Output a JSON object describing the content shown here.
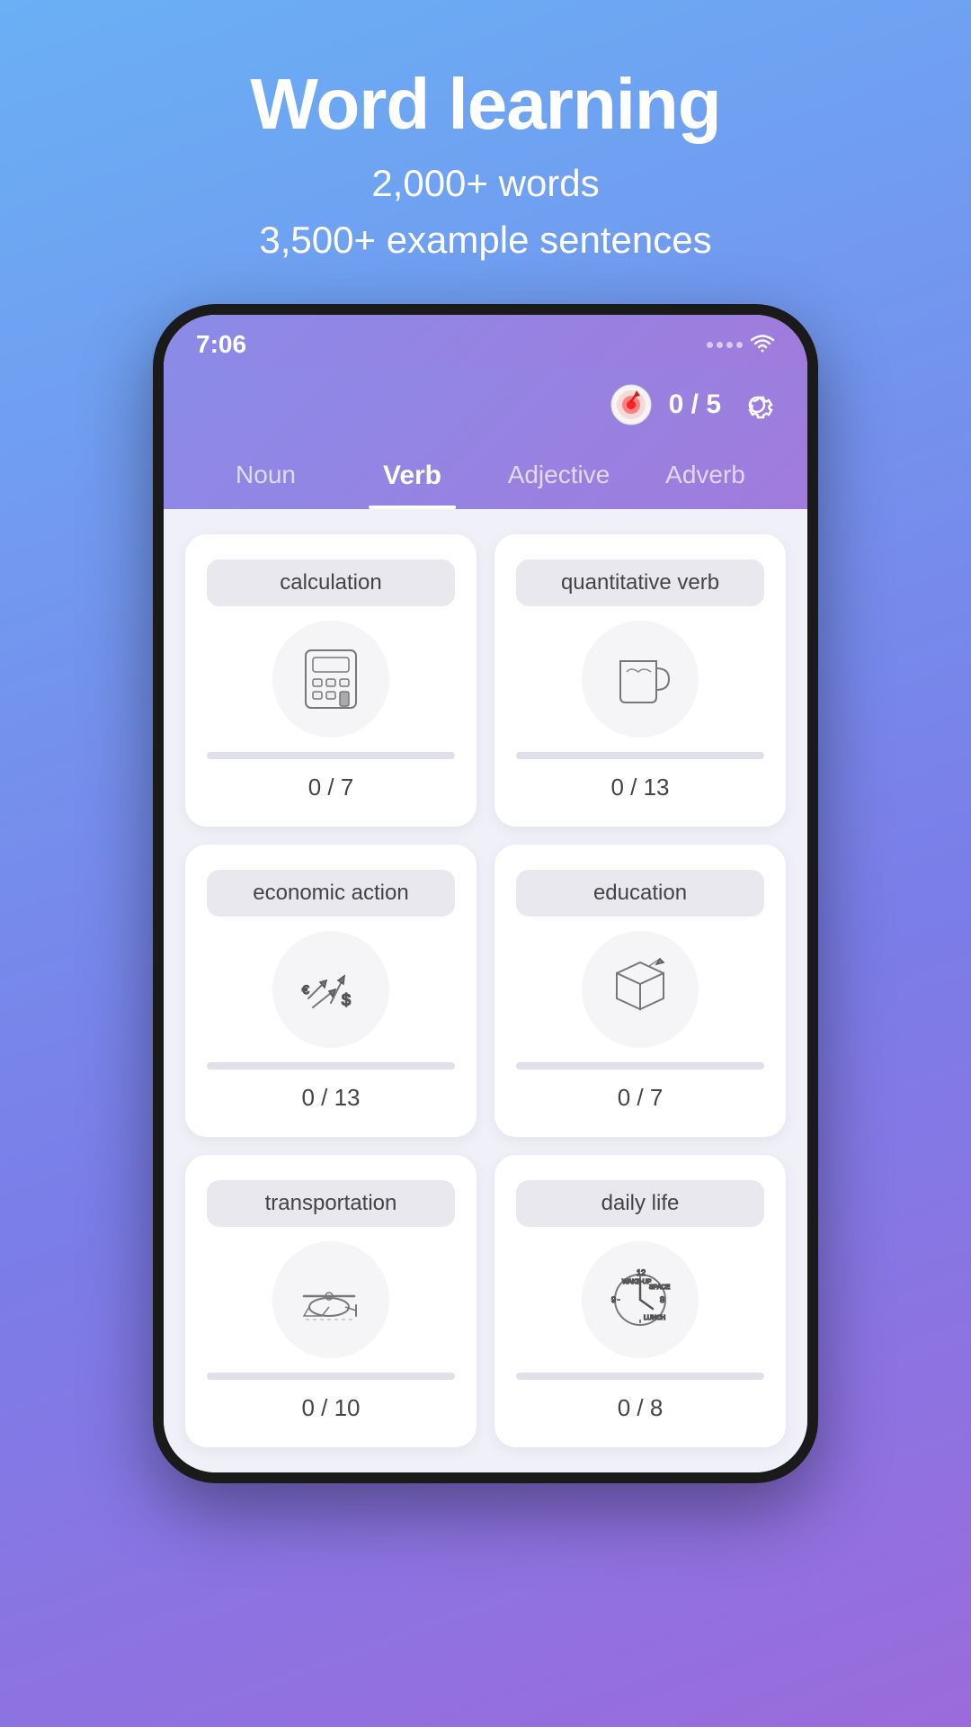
{
  "header": {
    "title": "Word learning",
    "subtitle_line1": "2,000+ words",
    "subtitle_line2": "3,500+ example sentences"
  },
  "status_bar": {
    "time": "7:06"
  },
  "app_header": {
    "score_label": "0 / 5"
  },
  "tabs": [
    {
      "label": "Noun",
      "active": false
    },
    {
      "label": "Verb",
      "active": true
    },
    {
      "label": "Adjective",
      "active": false
    },
    {
      "label": "Adverb",
      "active": false
    }
  ],
  "cards": [
    {
      "label": "calculation",
      "icon": "calculator",
      "score": "0 / 7"
    },
    {
      "label": "quantitative verb",
      "icon": "mug",
      "score": "0 / 13"
    },
    {
      "label": "economic action",
      "icon": "arrows",
      "score": "0 / 13"
    },
    {
      "label": "education",
      "icon": "book",
      "score": "0 / 7"
    },
    {
      "label": "transportation",
      "icon": "helicopter",
      "score": "0 / 10"
    },
    {
      "label": "daily life",
      "icon": "clock",
      "score": "0 / 8"
    }
  ]
}
